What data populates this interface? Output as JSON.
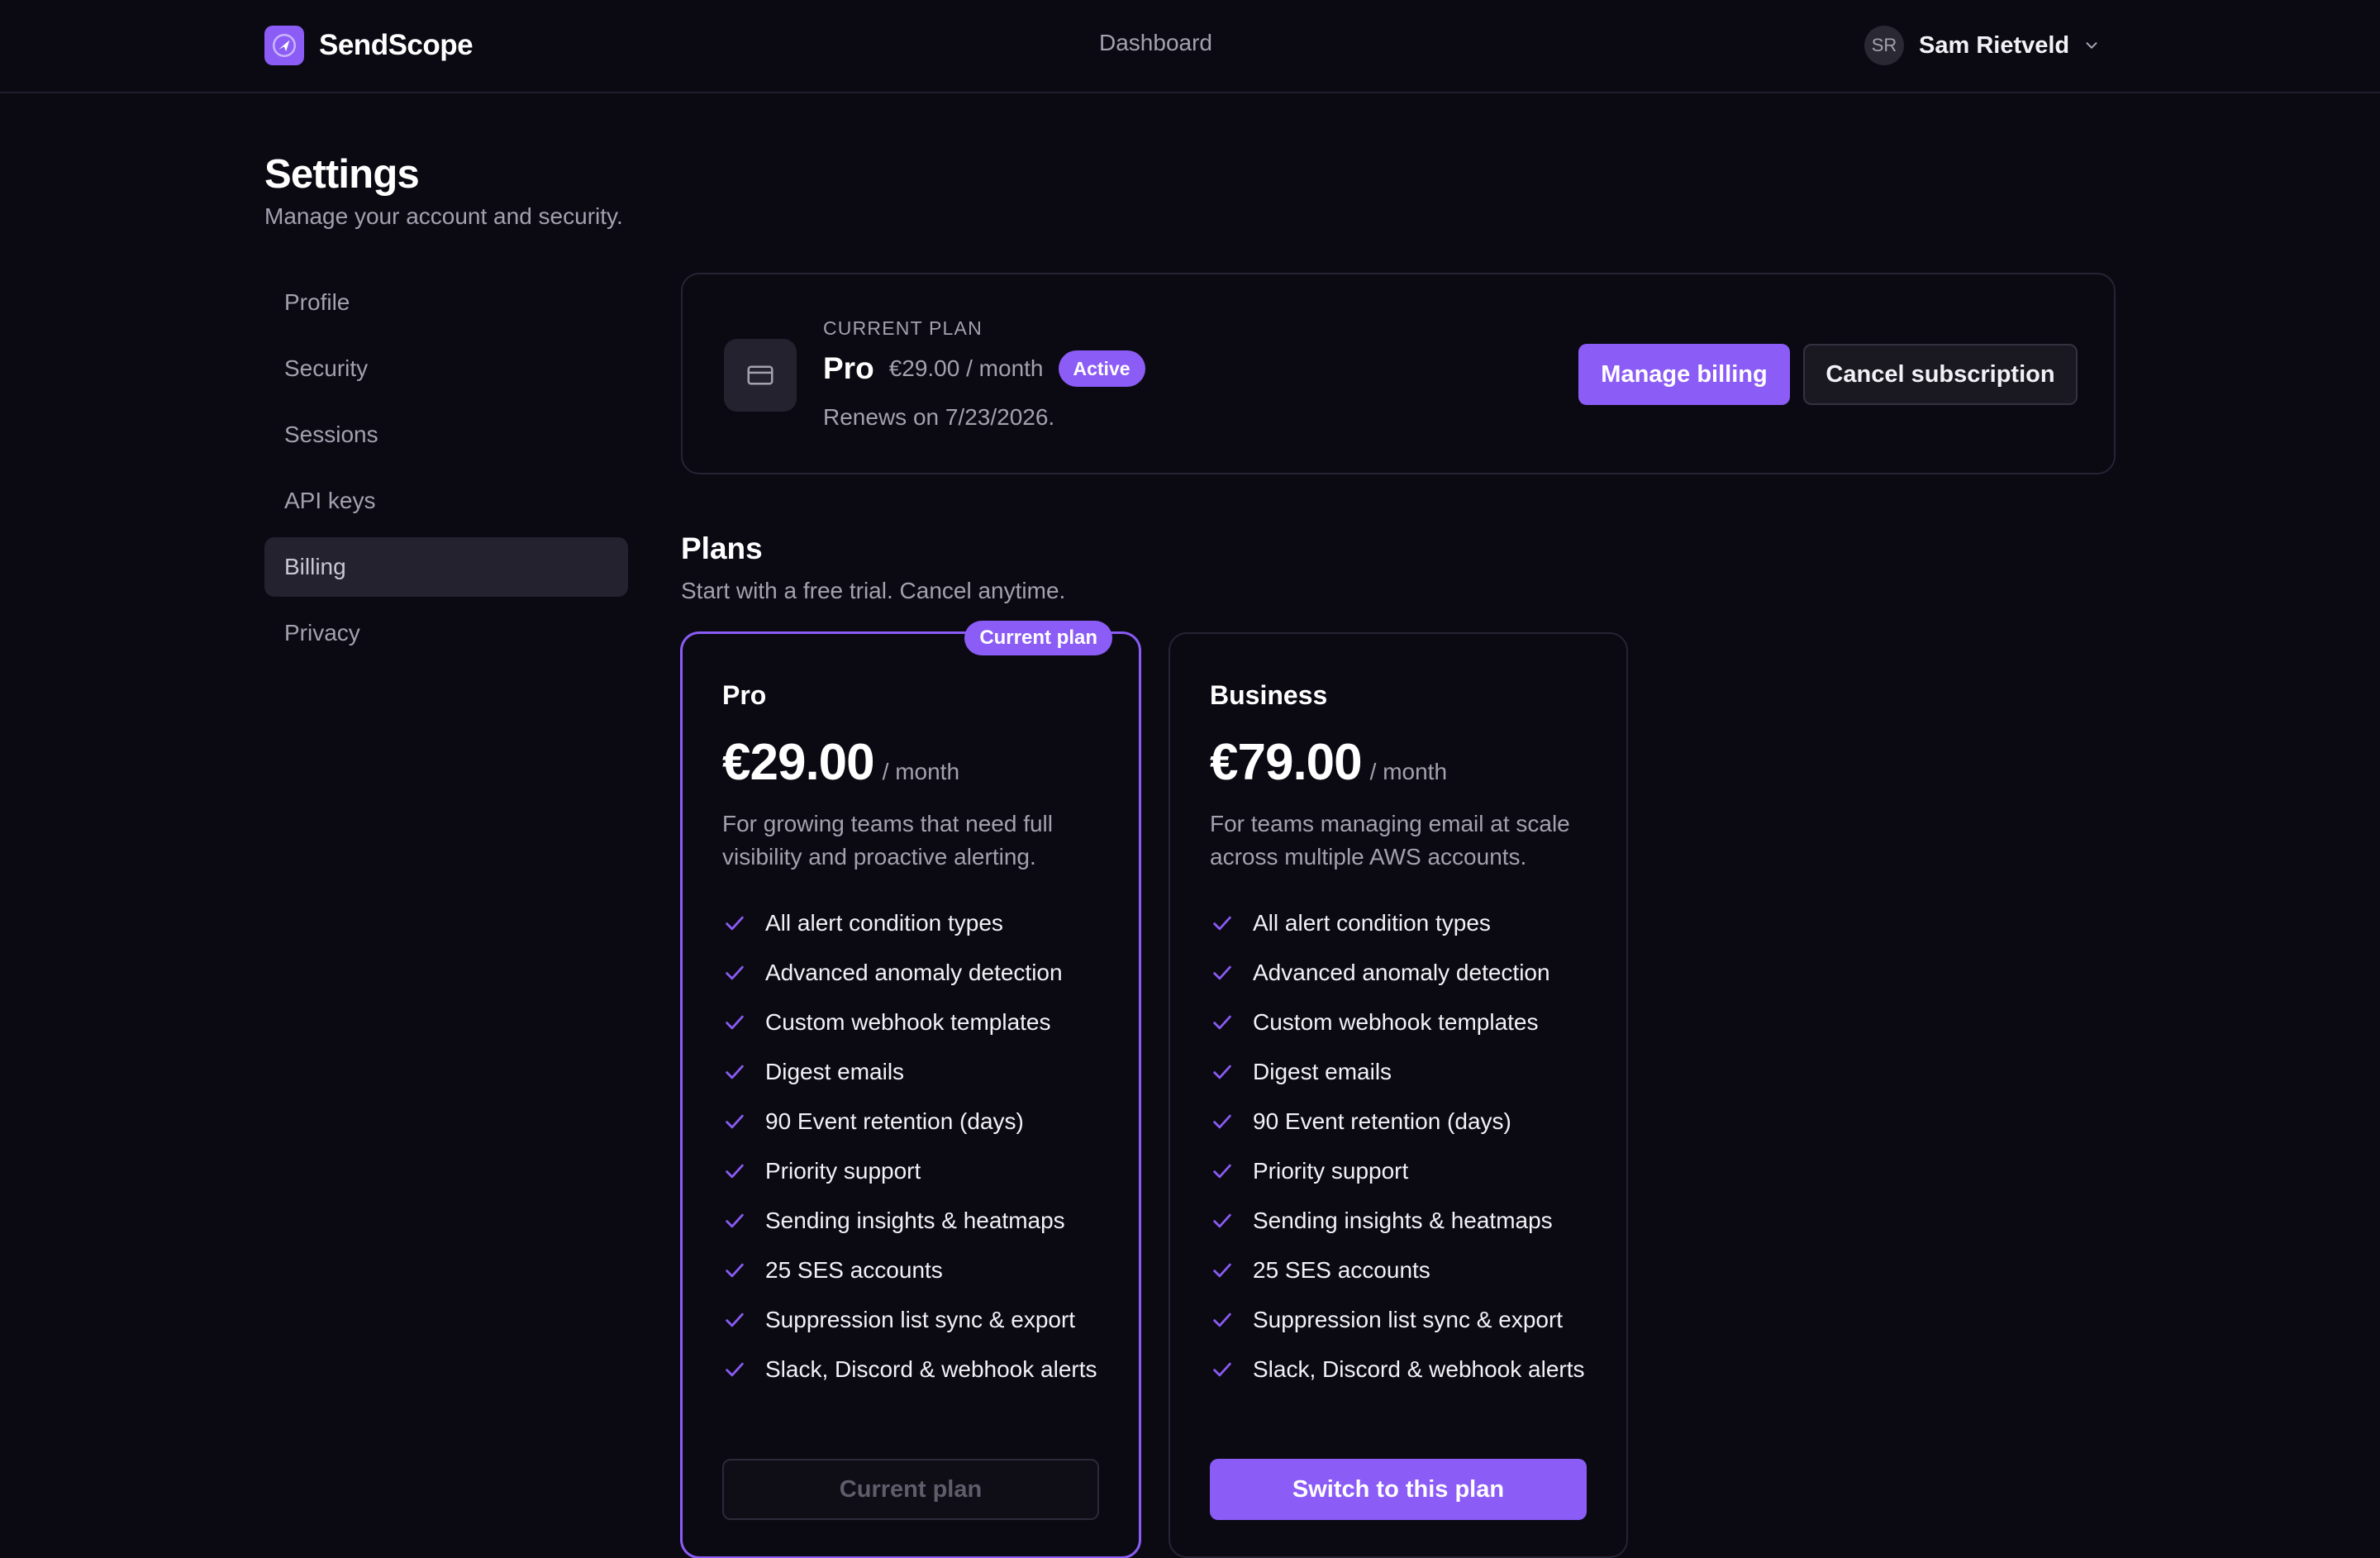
{
  "brand": {
    "name": "SendScope",
    "logo_icon": "send-compass-icon"
  },
  "nav": {
    "dashboard": "Dashboard"
  },
  "user": {
    "initials": "SR",
    "name": "Sam Rietveld"
  },
  "page": {
    "title": "Settings",
    "subtitle": "Manage your account and security."
  },
  "sidebar": {
    "items": [
      {
        "label": "Profile"
      },
      {
        "label": "Security"
      },
      {
        "label": "Sessions"
      },
      {
        "label": "API keys"
      },
      {
        "label": "Billing",
        "active": true
      },
      {
        "label": "Privacy"
      }
    ]
  },
  "current_plan": {
    "eyebrow": "CURRENT PLAN",
    "name": "Pro",
    "price": "€29.00 / month",
    "status": "Active",
    "renews": "Renews on 7/23/2026.",
    "manage_label": "Manage billing",
    "cancel_label": "Cancel subscription"
  },
  "plans": {
    "title": "Plans",
    "subtitle": "Start with a free trial. Cancel anytime.",
    "tiers": [
      {
        "name": "Pro",
        "badge": "Current plan",
        "amount": "€29.00",
        "period": "/ month",
        "description": "For growing teams that need full visibility and proactive alerting.",
        "features": [
          "All alert condition types",
          "Advanced anomaly detection",
          "Custom webhook templates",
          "Digest emails",
          "90 Event retention (days)",
          "Priority support",
          "Sending insights & heatmaps",
          "25 SES accounts",
          "Suppression list sync & export",
          "Slack, Discord & webhook alerts"
        ],
        "cta": "Current plan"
      },
      {
        "name": "Business",
        "amount": "€79.00",
        "period": "/ month",
        "description": "For teams managing email at scale across multiple AWS accounts.",
        "features": [
          "All alert condition types",
          "Advanced anomaly detection",
          "Custom webhook templates",
          "Digest emails",
          "90 Event retention (days)",
          "Priority support",
          "Sending insights & heatmaps",
          "25 SES accounts",
          "Suppression list sync & export",
          "Slack, Discord & webhook alerts"
        ],
        "cta": "Switch to this plan"
      }
    ]
  },
  "colors": {
    "background": "#0b0a13",
    "accent": "#8b5cf6",
    "muted_text": "#a3a1ad",
    "card_border": "#262433"
  }
}
